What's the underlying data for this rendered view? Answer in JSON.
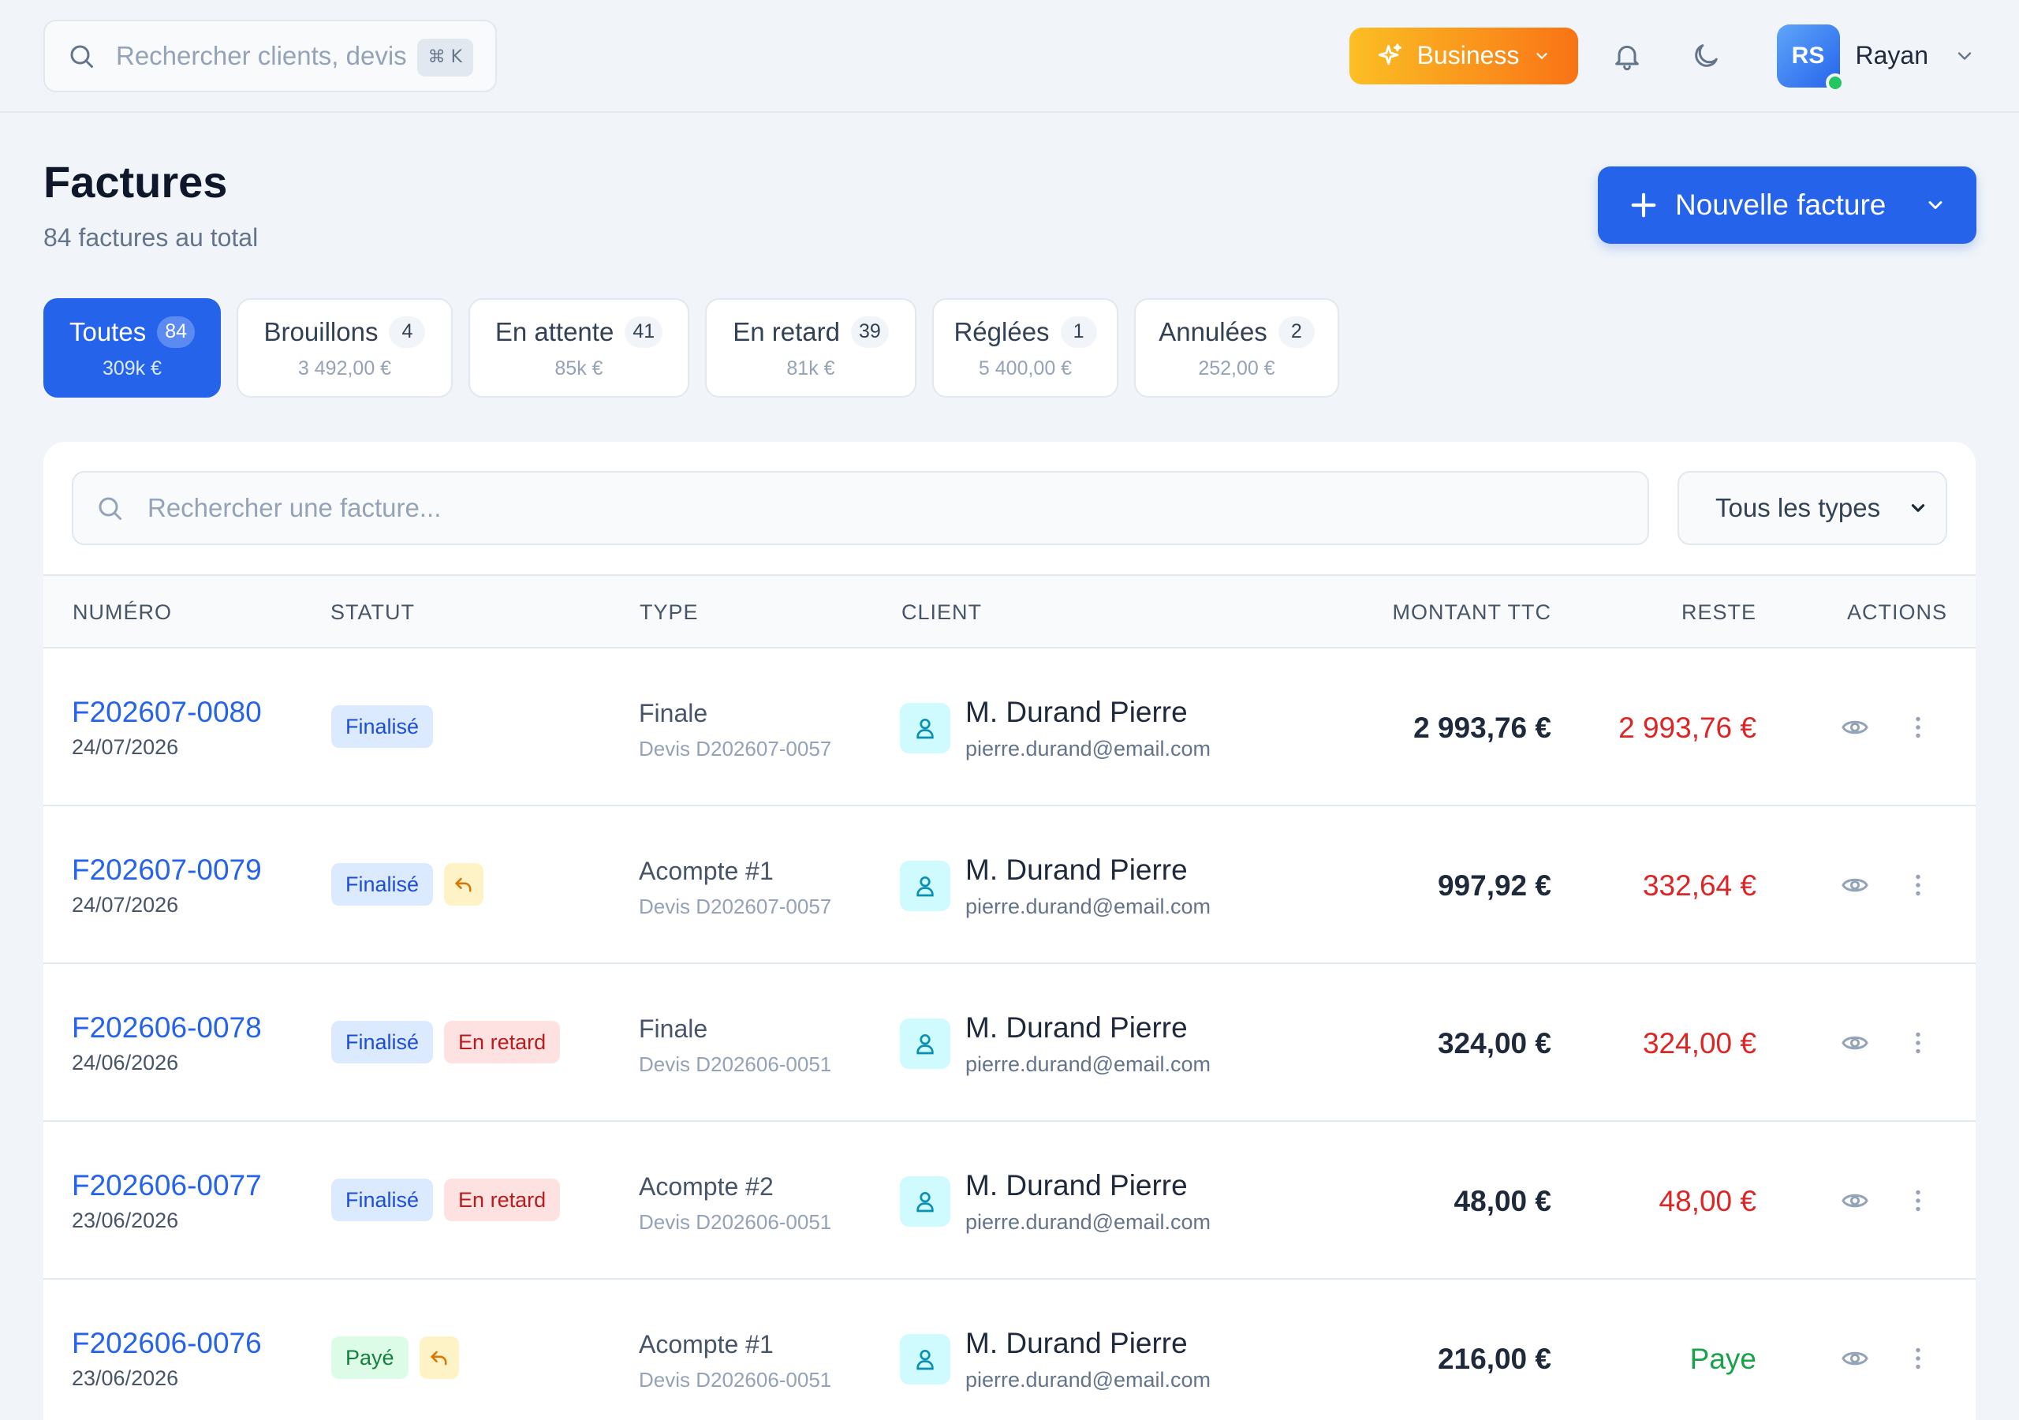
{
  "topbar": {
    "search_placeholder": "Rechercher clients, devis",
    "search_shortcut": "⌘ K",
    "plan_label": "Business",
    "user_initials": "RS",
    "user_name": "Rayan"
  },
  "header": {
    "title": "Factures",
    "subtitle": "84 factures au total",
    "new_invoice_label": "Nouvelle facture"
  },
  "tabs": [
    {
      "label": "Toutes",
      "count": "84",
      "amount": "309k €",
      "active": true
    },
    {
      "label": "Brouillons",
      "count": "4",
      "amount": "3 492,00 €",
      "active": false
    },
    {
      "label": "En attente",
      "count": "41",
      "amount": "85k €",
      "active": false
    },
    {
      "label": "En retard",
      "count": "39",
      "amount": "81k €",
      "active": false
    },
    {
      "label": "Réglées",
      "count": "1",
      "amount": "5 400,00 €",
      "active": false
    },
    {
      "label": "Annulées",
      "count": "2",
      "amount": "252,00 €",
      "active": false
    }
  ],
  "toolbar": {
    "search_placeholder": "Rechercher une facture...",
    "type_filter_value": "Tous les types"
  },
  "table": {
    "columns": {
      "number": "NUMÉRO",
      "status": "STATUT",
      "type": "TYPE",
      "client": "CLIENT",
      "amount": "MONTANT TTC",
      "remaining": "RESTE",
      "actions": "ACTIONS"
    },
    "rows": [
      {
        "number": "F202607-0080",
        "date": "24/07/2026",
        "status": "Finalisé",
        "status_kind": "finalise",
        "has_reply": false,
        "extra_badge": "",
        "type": "Finale",
        "quote": "Devis D202607-0057",
        "client_name": "M. Durand Pierre",
        "client_email": "pierre.durand@email.com",
        "amount": "2 993,76 €",
        "remaining": "2 993,76 €",
        "remaining_kind": "due"
      },
      {
        "number": "F202607-0079",
        "date": "24/07/2026",
        "status": "Finalisé",
        "status_kind": "finalise",
        "has_reply": true,
        "extra_badge": "",
        "type": "Acompte #1",
        "quote": "Devis D202607-0057",
        "client_name": "M. Durand Pierre",
        "client_email": "pierre.durand@email.com",
        "amount": "997,92 €",
        "remaining": "332,64 €",
        "remaining_kind": "due"
      },
      {
        "number": "F202606-0078",
        "date": "24/06/2026",
        "status": "Finalisé",
        "status_kind": "finalise",
        "has_reply": false,
        "extra_badge": "En retard",
        "type": "Finale",
        "quote": "Devis D202606-0051",
        "client_name": "M. Durand Pierre",
        "client_email": "pierre.durand@email.com",
        "amount": "324,00 €",
        "remaining": "324,00 €",
        "remaining_kind": "due"
      },
      {
        "number": "F202606-0077",
        "date": "23/06/2026",
        "status": "Finalisé",
        "status_kind": "finalise",
        "has_reply": false,
        "extra_badge": "En retard",
        "type": "Acompte #2",
        "quote": "Devis D202606-0051",
        "client_name": "M. Durand Pierre",
        "client_email": "pierre.durand@email.com",
        "amount": "48,00 €",
        "remaining": "48,00 €",
        "remaining_kind": "due"
      },
      {
        "number": "F202606-0076",
        "date": "23/06/2026",
        "status": "Payé",
        "status_kind": "paye",
        "has_reply": true,
        "extra_badge": "",
        "type": "Acompte #1",
        "quote": "Devis D202606-0051",
        "client_name": "M. Durand Pierre",
        "client_email": "pierre.durand@email.com",
        "amount": "216,00 €",
        "remaining": "Paye",
        "remaining_kind": "paid"
      }
    ]
  },
  "colors": {
    "accent": "#2563eb",
    "plan_gradient_start": "#fbbf24",
    "plan_gradient_end": "#f97316",
    "due": "#dc2626",
    "paid": "#16a34a"
  },
  "icons": {
    "search": "search-icon",
    "plan": "sparkles-icon",
    "notifications": "bell-icon",
    "theme": "moon-icon",
    "new": "plus-icon",
    "client": "user-icon",
    "view": "eye-icon",
    "more": "more-vertical-icon",
    "reply": "reply-icon"
  }
}
